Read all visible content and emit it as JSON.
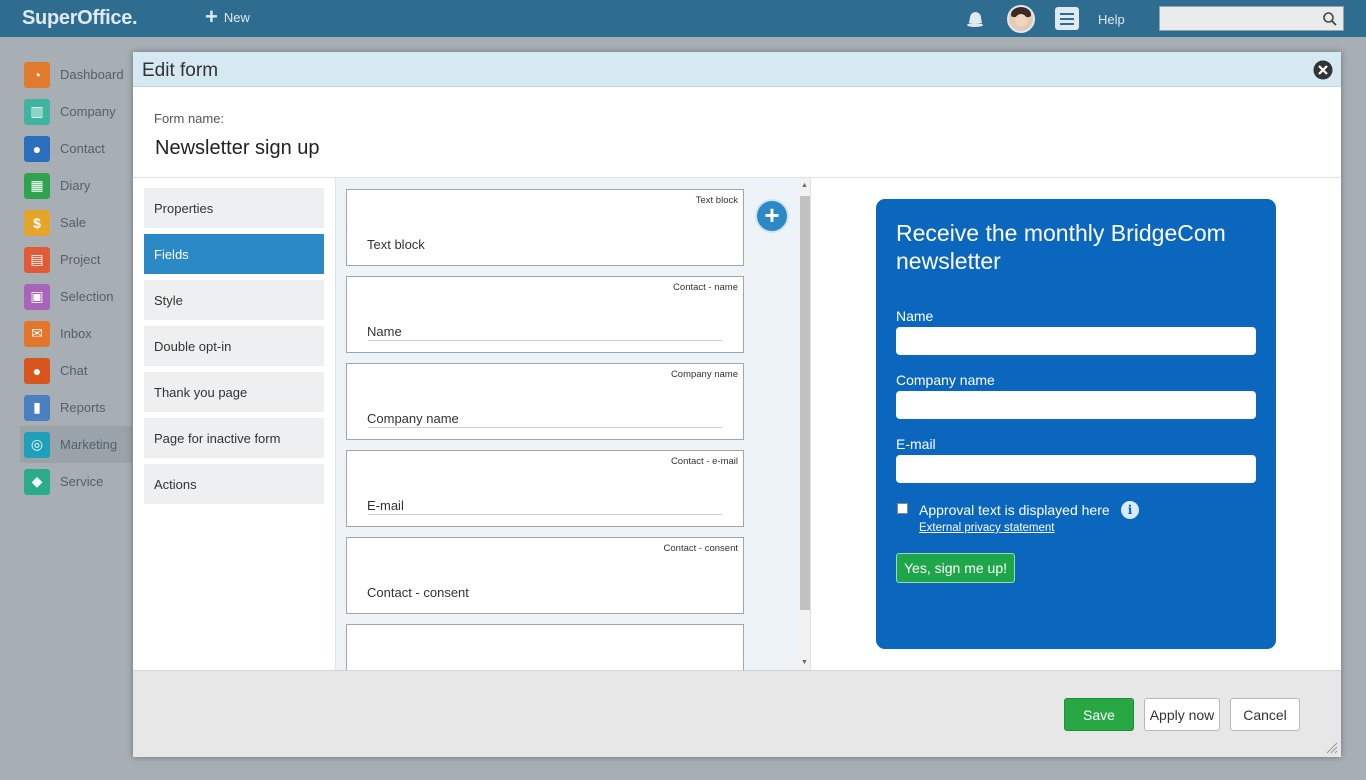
{
  "topbar": {
    "logo": "SuperOffice.",
    "new_label": "New",
    "help_label": "Help",
    "search_value": ""
  },
  "nav": {
    "items": [
      {
        "label": "Dashboard",
        "icon": "dashboard-icon",
        "color": "#e07b2e"
      },
      {
        "label": "Company",
        "icon": "company-icon",
        "color": "#3fb4a0"
      },
      {
        "label": "Contact",
        "icon": "contact-icon",
        "color": "#2a6ebc"
      },
      {
        "label": "Diary",
        "icon": "diary-icon",
        "color": "#2fa34f"
      },
      {
        "label": "Sale",
        "icon": "sale-icon",
        "color": "#e6a42a"
      },
      {
        "label": "Project",
        "icon": "project-icon",
        "color": "#e05a36"
      },
      {
        "label": "Selection",
        "icon": "selection-icon",
        "color": "#a864b8"
      },
      {
        "label": "Inbox",
        "icon": "inbox-icon",
        "color": "#e3762a"
      },
      {
        "label": "Chat",
        "icon": "chat-icon",
        "color": "#d9551e"
      },
      {
        "label": "Reports",
        "icon": "reports-icon",
        "color": "#4a80c2"
      },
      {
        "label": "Marketing",
        "icon": "marketing-icon",
        "color": "#1f9fb9",
        "active": true
      },
      {
        "label": "Service",
        "icon": "service-icon",
        "color": "#2aab8a"
      }
    ]
  },
  "modal": {
    "title": "Edit form",
    "form_name_label": "Form name:",
    "form_name": "Newsletter sign up",
    "tabs": [
      {
        "label": "Properties"
      },
      {
        "label": "Fields",
        "active": true
      },
      {
        "label": "Style"
      },
      {
        "label": "Double opt-in"
      },
      {
        "label": "Thank you page"
      },
      {
        "label": "Page for inactive form"
      },
      {
        "label": "Actions"
      }
    ],
    "fields": [
      {
        "type": "Text block",
        "label": "Text block",
        "has_line": false
      },
      {
        "type": "Contact - name",
        "label": "Name",
        "has_line": true
      },
      {
        "type": "Company name",
        "label": "Company name",
        "has_line": true
      },
      {
        "type": "Contact - e-mail",
        "label": "E-mail",
        "has_line": true
      },
      {
        "type": "Contact - consent",
        "label": "Contact - consent",
        "has_line": false
      },
      {
        "type": "",
        "label": "",
        "has_line": false
      }
    ],
    "preview": {
      "title": "Receive the monthly BridgeCom newsletter",
      "name_label": "Name",
      "company_label": "Company name",
      "email_label": "E-mail",
      "approval_text": "Approval text is displayed here",
      "privacy_link": "External privacy statement",
      "submit_label": "Yes, sign me up!",
      "background_color": "#0a67bd"
    },
    "footer": {
      "save_label": "Save",
      "apply_label": "Apply now",
      "cancel_label": "Cancel"
    }
  }
}
